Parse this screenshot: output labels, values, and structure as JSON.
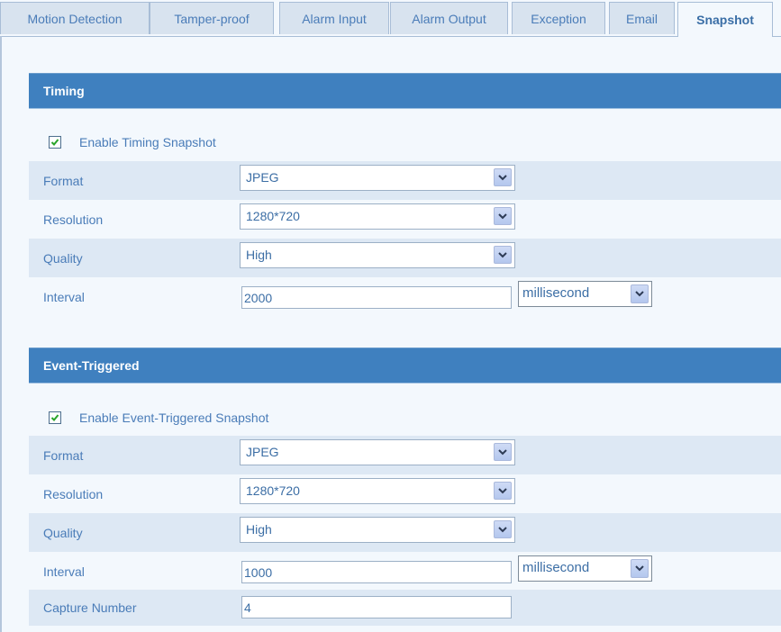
{
  "tabs": [
    {
      "label": "Motion Detection",
      "active": false
    },
    {
      "label": "Tamper-proof",
      "active": false
    },
    {
      "label": "Alarm Input",
      "active": false
    },
    {
      "label": "Alarm Output",
      "active": false
    },
    {
      "label": "Exception",
      "active": false
    },
    {
      "label": "Email",
      "active": false
    },
    {
      "label": "Snapshot",
      "active": true
    }
  ],
  "timing": {
    "title": "Timing",
    "enable_label": "Enable Timing Snapshot",
    "enabled": true,
    "format_label": "Format",
    "format_value": "JPEG",
    "resolution_label": "Resolution",
    "resolution_value": "1280*720",
    "quality_label": "Quality",
    "quality_value": "High",
    "interval_label": "Interval",
    "interval_value": "2000",
    "interval_unit": "millisecond"
  },
  "event": {
    "title": "Event-Triggered",
    "enable_label": "Enable Event-Triggered Snapshot",
    "enabled": true,
    "format_label": "Format",
    "format_value": "JPEG",
    "resolution_label": "Resolution",
    "resolution_value": "1280*720",
    "quality_label": "Quality",
    "quality_value": "High",
    "interval_label": "Interval",
    "interval_value": "1000",
    "interval_unit": "millisecond",
    "capture_label": "Capture Number",
    "capture_value": "4"
  },
  "icons": {
    "checkbox_check": "checkmark-icon",
    "dropdown_arrow": "chevron-down-icon"
  }
}
